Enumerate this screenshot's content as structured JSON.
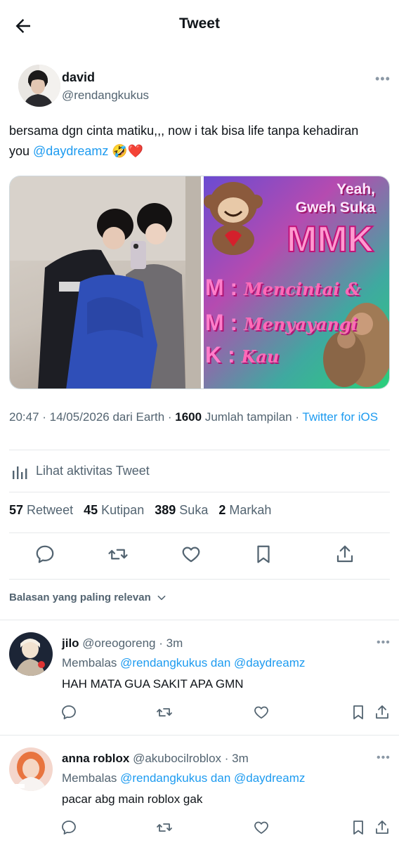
{
  "header": {
    "title": "Tweet"
  },
  "tweet": {
    "author_name": "david",
    "author_handle": "@rendangkukus",
    "text_before": "bersama dgn cinta matiku,,, now i tak bisa life tanpa kehadiran you ",
    "mention": "@daydreamz",
    "emoji": " 🤣❤️",
    "media_meme": {
      "yeah_line1": "Yeah,",
      "yeah_line2": "Gweh Suka",
      "mmk": "MMK",
      "line1_letter": "M",
      "line1_word": "Mencintai &",
      "line2_letter": "M",
      "line2_word": "Menyayangi",
      "line3_letter": "K",
      "line3_word": "Kau"
    },
    "meta": {
      "time_date": "20:47 · 14/05/2026 dari Earth · ",
      "views_count": "1600",
      "views_label": " Jumlah tampilan · ",
      "client": "Twitter for iOS"
    },
    "activity_label": "Lihat aktivitas Tweet",
    "stats": {
      "retweets": "57",
      "retweets_label": "Retweet",
      "quotes": "45",
      "quotes_label": "Kutipan",
      "likes": "389",
      "likes_label": "Suka",
      "bookmarks": "2",
      "bookmarks_label": "Markah"
    }
  },
  "replies_sort": "Balasan yang paling relevan",
  "replies": [
    {
      "name": "jilo",
      "handle": "@oreogoreng",
      "time": "· 3m",
      "replying_prefix": "Membalas ",
      "replying_to": "@rendangkukus dan @daydreamz",
      "text": "HAH MATA GUA SAKIT APA GMN"
    },
    {
      "name": "anna roblox",
      "handle": "@akubocilroblox",
      "time": "· 3m",
      "replying_prefix": "Membalas ",
      "replying_to": "@rendangkukus dan @daydreamz",
      "text": "pacar abg main roblox gak"
    }
  ],
  "colors": {
    "accent": "#1d9bf0",
    "text": "#0f1419",
    "secondary": "#536471",
    "divider": "#e6e9eb"
  }
}
